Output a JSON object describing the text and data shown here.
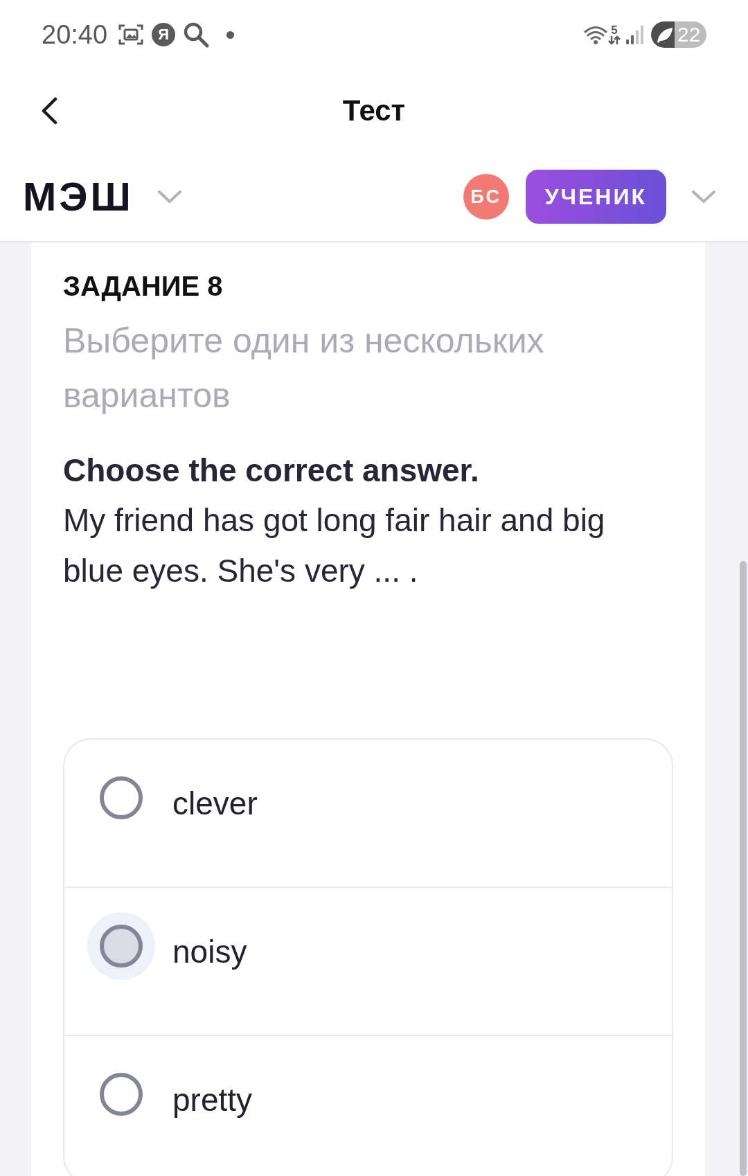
{
  "status_bar": {
    "time": "20:40",
    "app_badge": "Я",
    "network_type": "5",
    "battery": "22"
  },
  "title_bar": {
    "title": "Тест"
  },
  "app_header": {
    "logo": "МЭШ",
    "avatar_initials": "БС",
    "role": "УЧЕНИК"
  },
  "task": {
    "heading": "ЗАДАНИЕ 8",
    "hint": "Выберите один из нескольких вариантов",
    "instruction": "Choose the correct answer.",
    "question": "My friend has got long fair hair and big blue eyes. She's very ... ."
  },
  "options": [
    {
      "label": "clever",
      "selected": false,
      "focused": false
    },
    {
      "label": "noisy",
      "selected": false,
      "focused": true
    },
    {
      "label": "pretty",
      "selected": false,
      "focused": false
    }
  ]
}
